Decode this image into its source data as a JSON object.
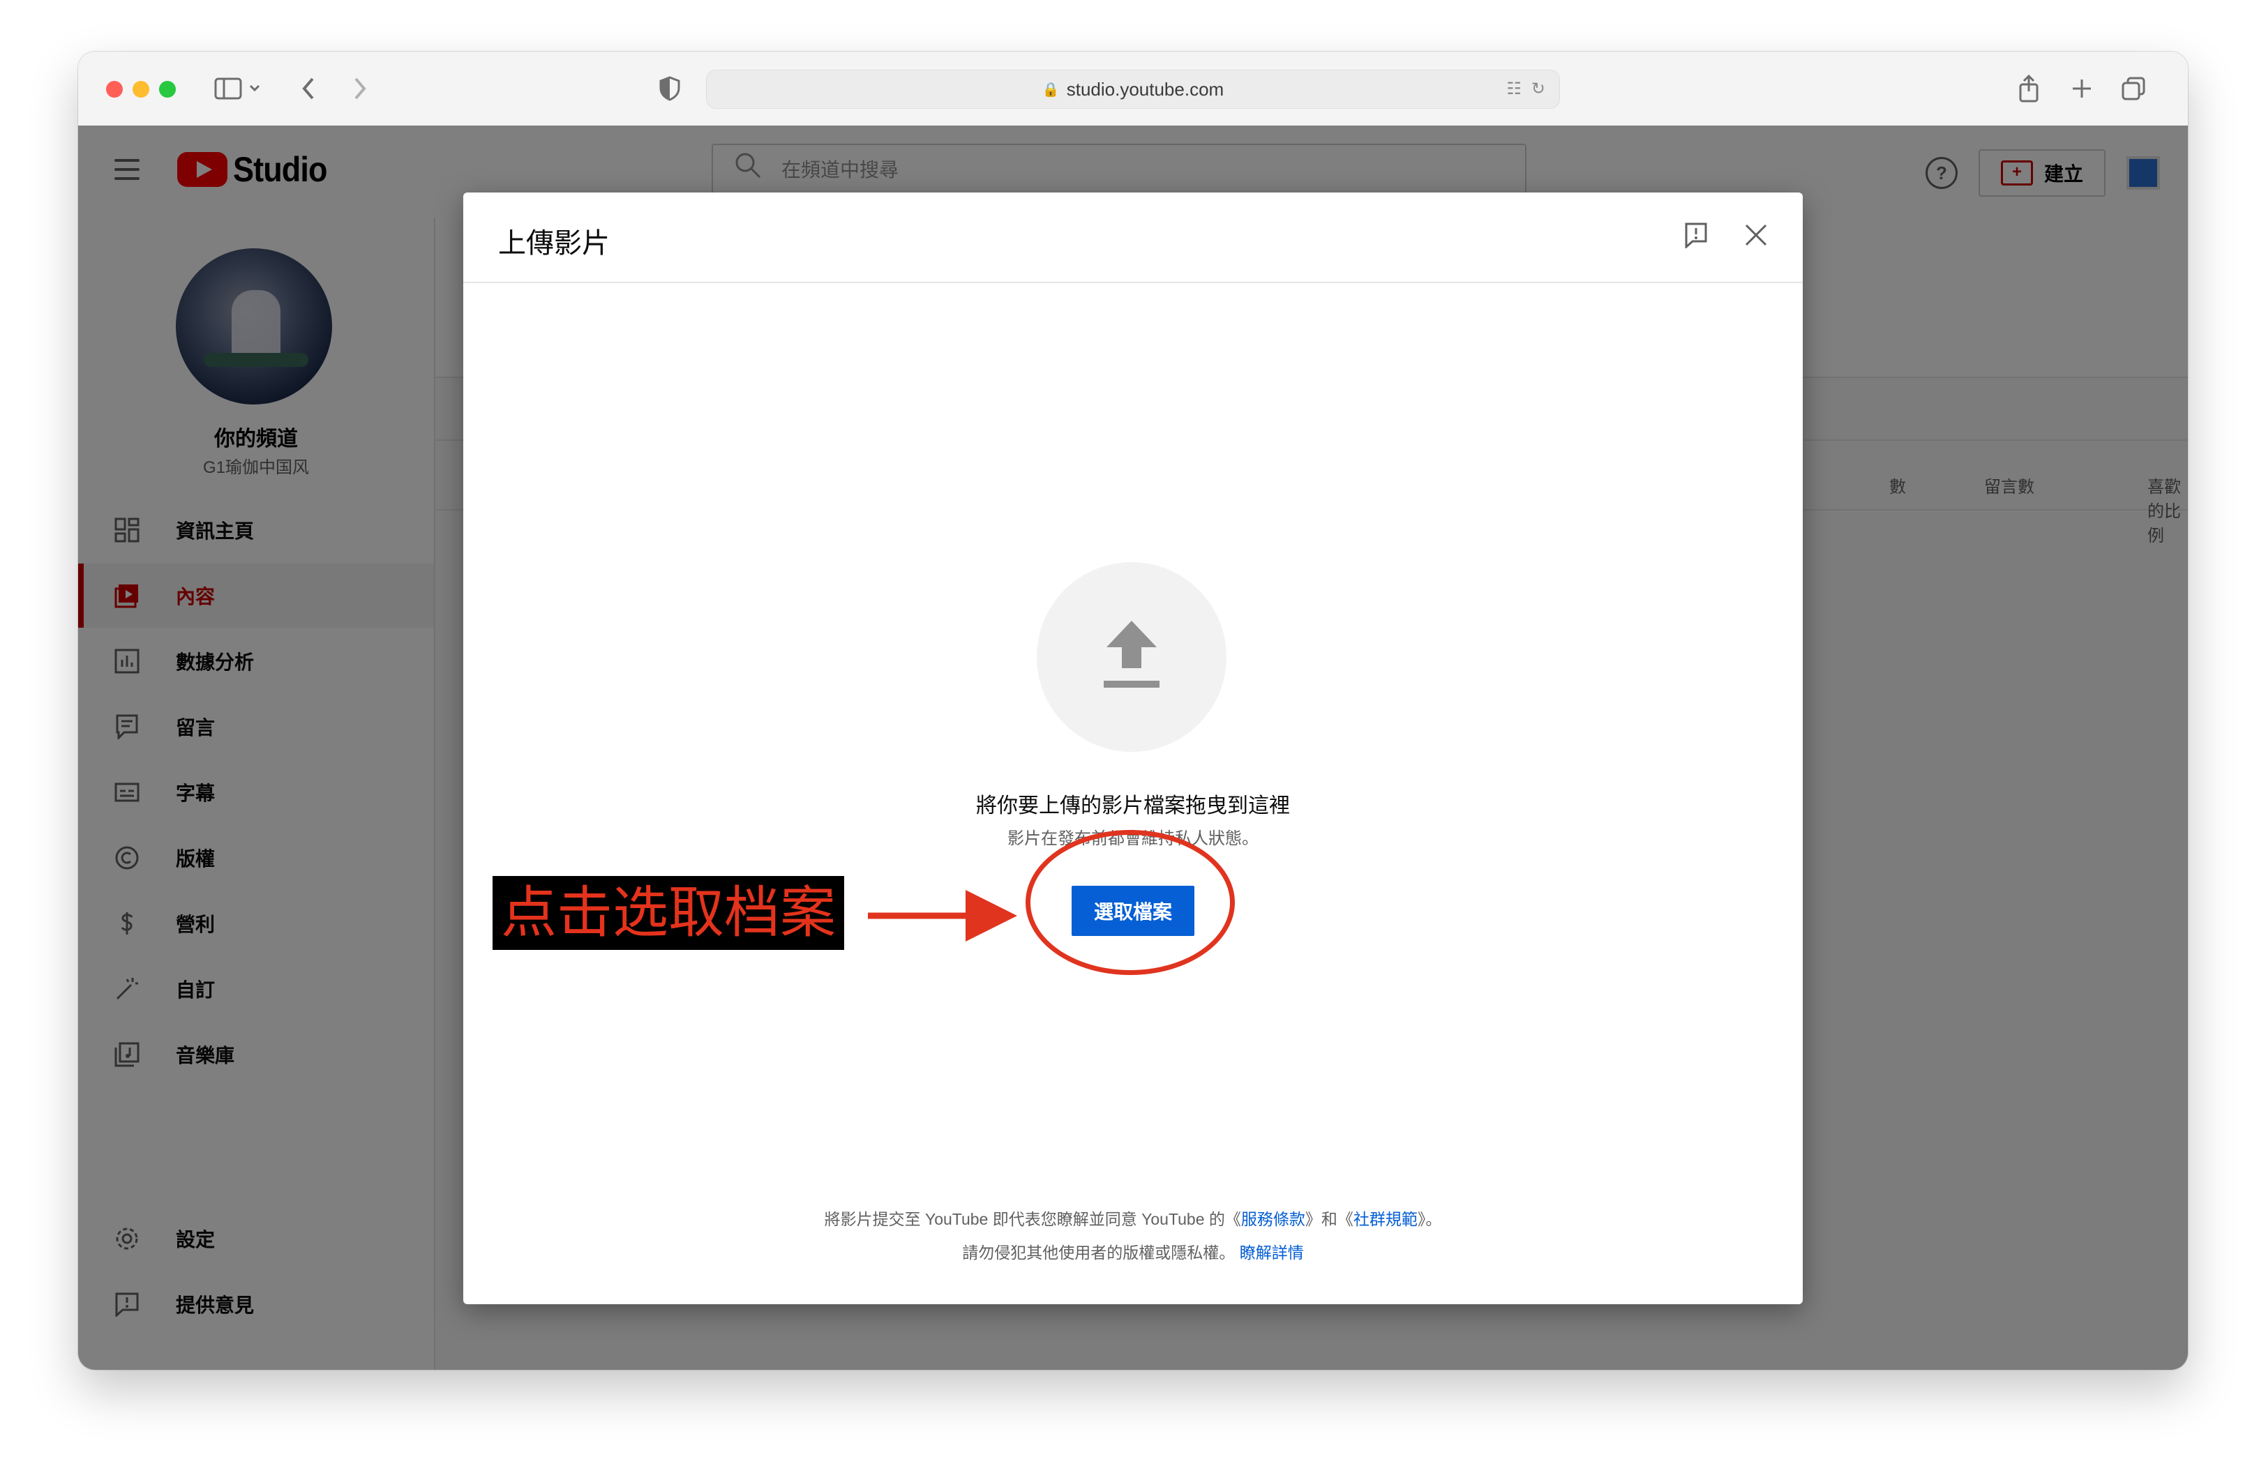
{
  "browser": {
    "url": "studio.youtube.com"
  },
  "header": {
    "logo_text": "Studio",
    "search_placeholder": "在頻道中搜尋",
    "create_label": "建立"
  },
  "sidebar": {
    "channel_name": "你的頻道",
    "channel_handle": "G1瑜伽中国风",
    "items": [
      {
        "label": "資訊主頁",
        "icon": "dashboard-icon"
      },
      {
        "label": "內容",
        "icon": "content-icon",
        "active": true
      },
      {
        "label": "數據分析",
        "icon": "analytics-icon"
      },
      {
        "label": "留言",
        "icon": "comments-icon"
      },
      {
        "label": "字幕",
        "icon": "subtitles-icon"
      },
      {
        "label": "版權",
        "icon": "copyright-icon"
      },
      {
        "label": "營利",
        "icon": "monetization-icon"
      },
      {
        "label": "自訂",
        "icon": "customization-icon"
      },
      {
        "label": "音樂庫",
        "icon": "audio-library-icon"
      }
    ],
    "settings_label": "設定",
    "feedback_label": "提供意見"
  },
  "table": {
    "columns": [
      "數",
      "留言數",
      "喜歡的比例"
    ]
  },
  "dialog": {
    "title": "上傳影片",
    "drop_text": "將你要上傳的影片檔案拖曳到這裡",
    "private_text": "影片在發布前都會維持私人狀態。",
    "select_button": "選取檔案",
    "terms_prefix": "將影片提交至 YouTube 即代表您瞭解並同意 YouTube 的《",
    "terms_link": "服務條款",
    "terms_middle": "》和《",
    "guidelines_link": "社群規範",
    "terms_suffix": "》。",
    "copyright_text": "請勿侵犯其他使用者的版權或隱私權。",
    "learn_more": "瞭解詳情"
  },
  "annotation": {
    "label": "点击选取档案",
    "color": "#e0341f"
  },
  "colors": {
    "brand_red": "#cc0000",
    "button_blue": "#065fd4"
  }
}
